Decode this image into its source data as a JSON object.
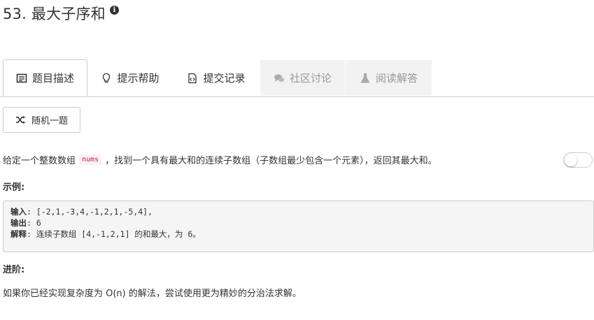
{
  "problem": {
    "title": "53. 最大子序和"
  },
  "tabs": [
    {
      "label": "题目描述",
      "icon": "description-icon",
      "state": "active"
    },
    {
      "label": "提示帮助",
      "icon": "lightbulb-icon",
      "state": "normal"
    },
    {
      "label": "提交记录",
      "icon": "code-file-icon",
      "state": "normal"
    },
    {
      "label": "社区讨论",
      "icon": "comments-icon",
      "state": "disabled"
    },
    {
      "label": "阅读解答",
      "icon": "flask-icon",
      "state": "disabled"
    }
  ],
  "random_button": {
    "label": "随机一题",
    "icon": "shuffle-icon"
  },
  "description": {
    "before": "给定一个整数数组",
    "code": "nums",
    "after": "，找到一个具有最大和的连续子数组（子数组最少包含一个元素），返回其最大和。"
  },
  "example": {
    "heading": "示例:",
    "input_label": "输入",
    "input_value": ": [-2,1,-3,4,-1,2,1,-5,4],",
    "output_label": "输出",
    "output_value": ": 6",
    "explain_label": "解释",
    "explain_value": ": 连续子数组 [4,-1,2,1] 的和最大，为 6。"
  },
  "followup": {
    "heading": "进阶:",
    "text": "如果你已经实现复杂度为 O(n) 的解法，尝试使用更为精妙的分治法求解。"
  },
  "colors": {
    "inline_code": "#c7254e",
    "inline_code_bg": "#f9f2f4",
    "disabled_tab_bg": "#f2f2f2",
    "border": "#cccccc"
  }
}
